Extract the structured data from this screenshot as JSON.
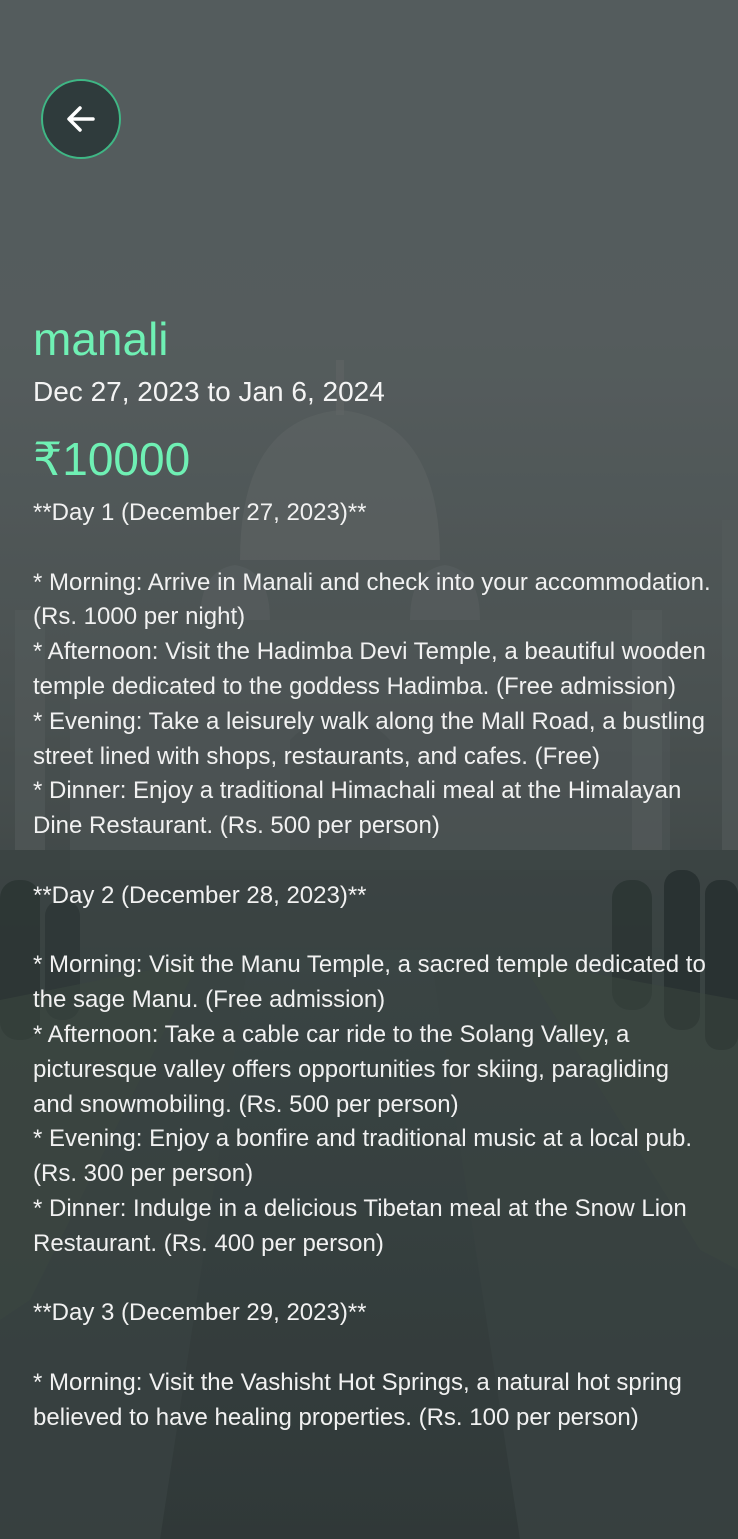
{
  "header": {
    "back_icon": "arrow-left-icon"
  },
  "trip": {
    "destination": "manali",
    "date_range": "Dec 27, 2023 to Jan 6, 2024",
    "price": "₹10000",
    "itinerary": "**Day 1 (December 27, 2023)**\n\n* Morning: Arrive in Manali and check into your accommodation. (Rs. 1000 per night)\n* Afternoon: Visit the Hadimba Devi Temple, a beautiful wooden temple dedicated to the goddess Hadimba. (Free admission)\n* Evening: Take a leisurely walk along the Mall Road, a bustling street lined with shops, restaurants, and cafes. (Free)\n* Dinner: Enjoy a traditional Himachali meal at the Himalayan Dine Restaurant. (Rs. 500 per person)\n\n**Day 2 (December 28, 2023)**\n\n* Morning: Visit the Manu Temple, a sacred temple dedicated to the sage Manu. (Free admission)\n* Afternoon: Take a cable car ride to the Solang Valley, a picturesque valley offers opportunities for skiing, paragliding and snowmobiling. (Rs. 500 per person)\n* Evening: Enjoy a bonfire and traditional music at a local pub. (Rs. 300 per person)\n* Dinner: Indulge in a delicious Tibetan meal at the Snow Lion Restaurant. (Rs. 400 per person)\n\n**Day 3 (December 29, 2023)**\n\n* Morning: Visit the Vashisht Hot Springs, a natural hot spring believed to have healing properties. (Rs. 100 per person)"
  },
  "colors": {
    "accent": "#6ff0b4",
    "button_bg": "#2f3b3c",
    "button_border": "#3fb785",
    "text": "#f1f1f1"
  }
}
